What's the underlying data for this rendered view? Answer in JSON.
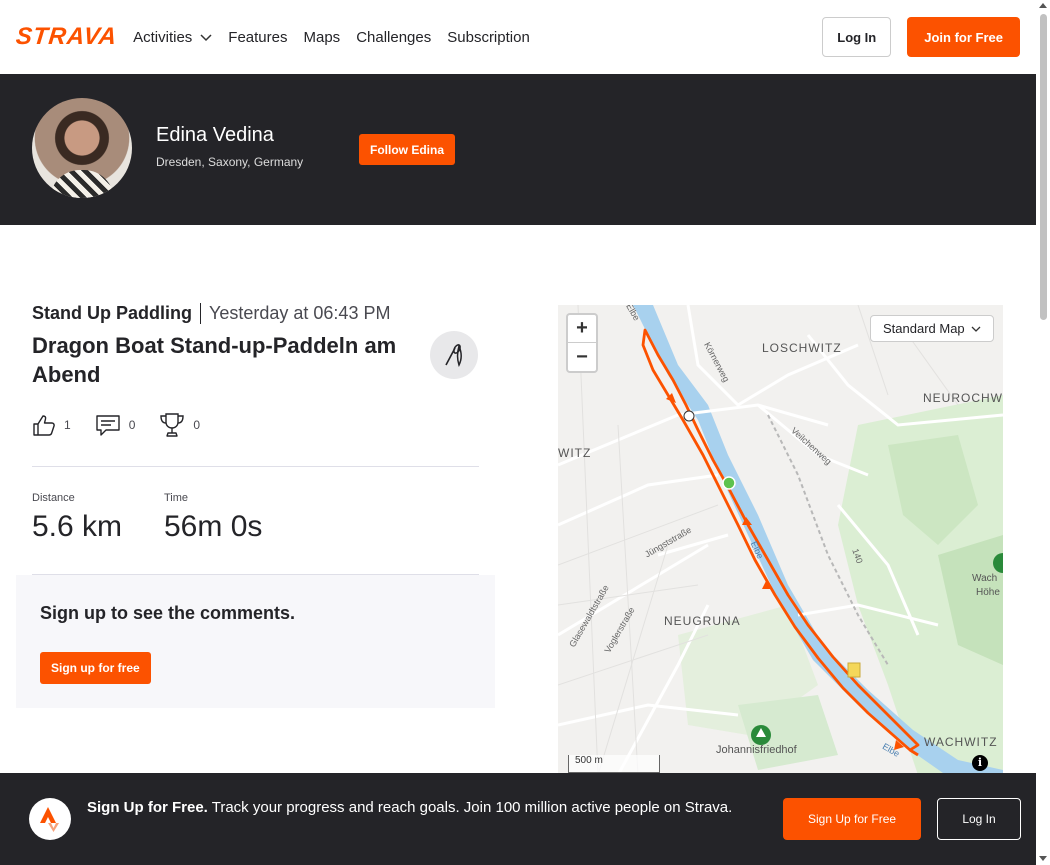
{
  "nav": {
    "logo": "STRAVA",
    "links": [
      "Activities",
      "Features",
      "Maps",
      "Challenges",
      "Subscription"
    ],
    "login_label": "Log In",
    "join_label": "Join for Free"
  },
  "athlete": {
    "name": "Edina Vedina",
    "location": "Dresden, Saxony, Germany",
    "follow_label": "Follow Edina"
  },
  "activity": {
    "sport": "Stand Up Paddling",
    "when": "Yesterday at 06:43 PM",
    "title": "Dragon Boat Stand-up-Paddeln am Abend",
    "kudos": "1",
    "comments": "0",
    "achievements": "0",
    "stats": [
      {
        "label": "Distance",
        "value": "5.6 km"
      },
      {
        "label": "Time",
        "value": "56m 0s"
      }
    ]
  },
  "comments_box": {
    "heading": "Sign up to see the comments.",
    "button": "Sign up for free"
  },
  "map": {
    "zoom_in": "+",
    "zoom_out": "−",
    "map_type": "Standard Map",
    "scale": "500 m",
    "info": "i",
    "labels": {
      "loschwitz": "LOSCHWITZ",
      "neurochw": "NEUROCHW",
      "witz": "WITZ",
      "neugruna": "NEUGRUNA",
      "wachwitz": "WACHWITZ",
      "johannisfriedhof": "Johannisfriedhof",
      "wach": "Wach",
      "hohe": "Höhe",
      "elbe1": "Elbe",
      "elbe2": "Elbe",
      "elbe3": "Elbe",
      "koernerweg": "Körnerweg",
      "veilchenweg": "Veilchenweg",
      "juengststrasse": "Jüngststraße",
      "glasewaldtstrasse": "Glasewaldtstraße",
      "voglerstrasse": "Voglerstraße",
      "road140": "140"
    },
    "route_color": "#fc5200",
    "start_color": "#5cc24e"
  },
  "banner": {
    "lead": "Sign Up for Free.",
    "text": " Track your progress and reach goals. Join 100 million active people on Strava.",
    "signup_label": "Sign Up for Free",
    "login_label": "Log In"
  }
}
